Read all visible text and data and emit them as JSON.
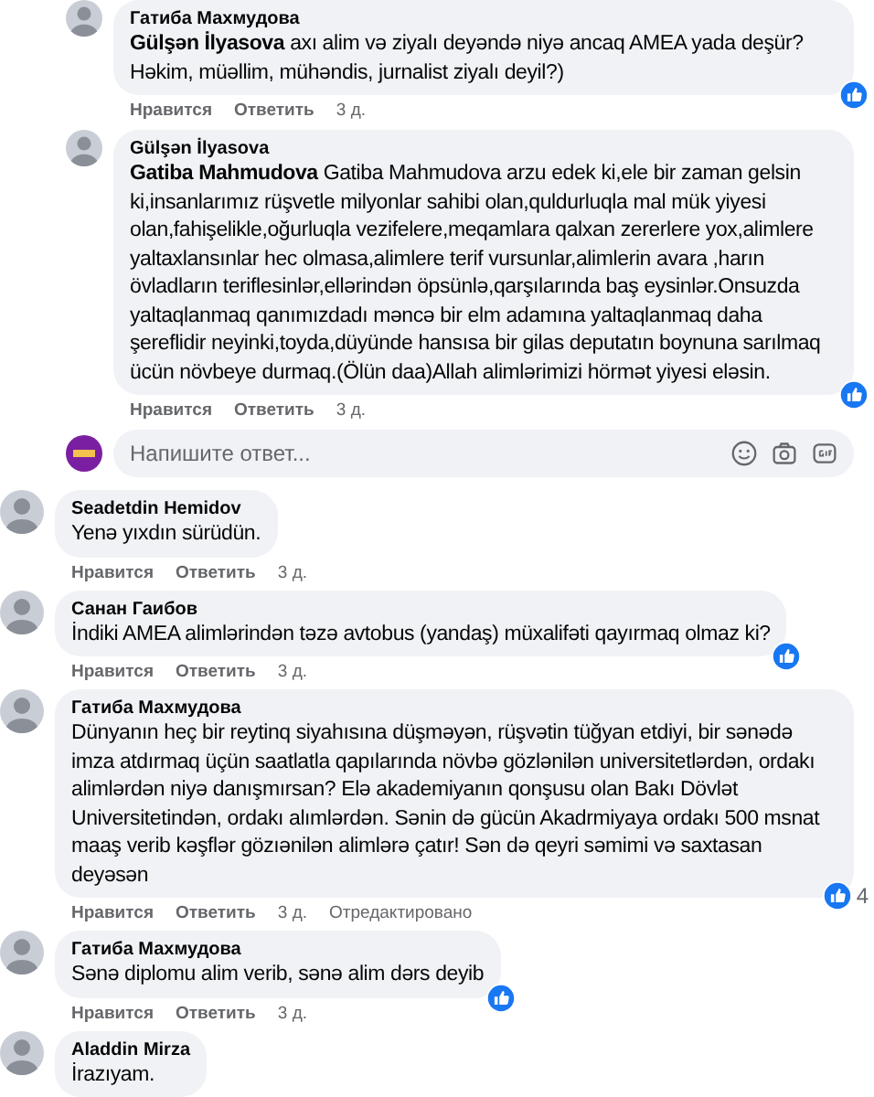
{
  "replies": [
    {
      "author": "Гатиба Махмудова",
      "text": "**Gülşən İlyasova** axı alim və ziyalı deyəndə niyə ancaq AMEA yada deşür? Həkim, müəllim, mühəndis, jurnalist ziyalı deyil?)",
      "liked": true,
      "actions": [
        "Нравится",
        "Ответить"
      ],
      "time": "3 д."
    },
    {
      "author": "Gülşən İlyasova",
      "text": "**Gatiba Mahmudova** Gatiba Mahmudova arzu edek ki,ele bir zaman gelsin ki,insanlarımız rüşvetle milyonlar sahibi olan,quldurluqla mal mük yiyesi olan,fahişelikle,oğurluqla vezifelere,meqamlara qalxan zererlere yox,alimlere yaltaxlansınlar hec olmasa,alimlere terif vursunlar,alimlerin avara ,harın övladların teriflesinlər,ellərindən öpsünlə,qarşılarında baş eysinlər.Onsuzda yaltaqlanmaq qanımızdadı məncə bir elm adamına yaltaqlanmaq daha şereflidir neyinki,toyda,düyünde hansısa bir gilas deputatın boynuna sarılmaq ücün növbeye durmaq.(Ölün daa)Allah alimlərimizi hörmət yiyesi eləsin.",
      "liked": true,
      "actions": [
        "Нравится",
        "Ответить"
      ],
      "time": "3 д."
    }
  ],
  "reply_box": {
    "placeholder": "Напишите ответ..."
  },
  "comments": [
    {
      "author": "Seadetdin Hemidov",
      "text": "Yenə yıxdın sürüdün.",
      "liked": false,
      "actions": [
        "Нравится",
        "Ответить"
      ],
      "time": "3 д."
    },
    {
      "author": "Санан Гаибов",
      "text": "İndiki AMEA alimlərindən təzə avtobus (yandaş) müxalifəti qayırmaq olmaz ki?",
      "liked": true,
      "actions": [
        "Нравится",
        "Ответить"
      ],
      "time": "3 д."
    },
    {
      "author": "Гатиба Махмудова",
      "text": "Dünyanın heç bir reytinq siyahısına düşməyən, rüşvətin tüğyan etdiyi, bir sənədə imza atdırmaq üçün saatlatla qapılarında növbə gözlənilən universitetlərdən, ordakı alimlərdən niyə danışmırsan? Elə akademiyanın qonşusu olan Bakı Dövlət Universitetindən, ordakı alımlərdən. Sənin də gücün Akadrmiyaya ordakı 500 msnat maaş verib kəşflər gözıənilən alimlərə çatır! Sən də qeyri səmimi və saxtasan deyəsən",
      "liked": true,
      "like_count": "4",
      "actions": [
        "Нравится",
        "Ответить"
      ],
      "time": "3 д.",
      "edited": "Отредактировано"
    },
    {
      "author": "Гатиба Махмудова",
      "text": "Sənə diplomu alim verib, sənə alim dərs deyib",
      "liked": true,
      "actions": [
        "Нравится",
        "Ответить"
      ],
      "time": "3 д."
    },
    {
      "author": "Aladdin Mirza",
      "text": "İrazıyam.",
      "liked": false
    }
  ]
}
